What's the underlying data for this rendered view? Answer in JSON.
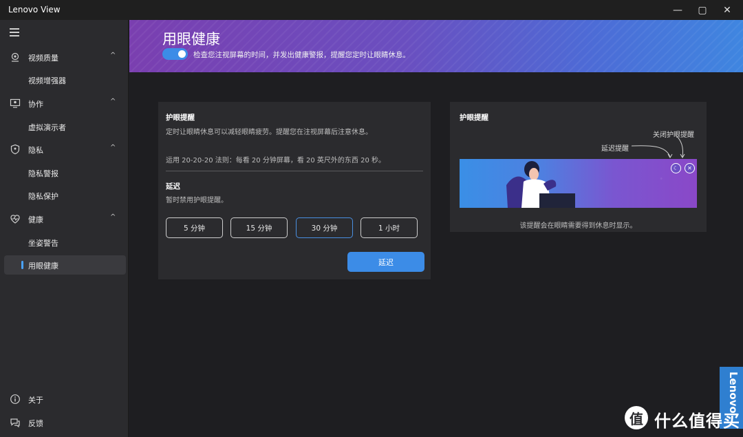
{
  "window": {
    "title": "Lenovo View",
    "minimize_glyph": "—",
    "maximize_glyph": "▢",
    "close_glyph": "✕"
  },
  "sidebar": {
    "menu_icon": "hamburger-icon",
    "groups": [
      {
        "label": "视频质量",
        "icon": "camera-icon",
        "expanded": true,
        "items": [
          {
            "label": "视频增强器"
          }
        ]
      },
      {
        "label": "协作",
        "icon": "presenter-icon",
        "expanded": true,
        "items": [
          {
            "label": "虚拟演示者"
          }
        ]
      },
      {
        "label": "隐私",
        "icon": "shield-icon",
        "expanded": true,
        "items": [
          {
            "label": "隐私警报"
          },
          {
            "label": "隐私保护"
          }
        ]
      },
      {
        "label": "健康",
        "icon": "heart-icon",
        "expanded": true,
        "items": [
          {
            "label": "坐姿警告"
          },
          {
            "label": "用眼健康",
            "active": true
          }
        ]
      }
    ],
    "footer": [
      {
        "label": "关于",
        "icon": "info-icon"
      },
      {
        "label": "反馈",
        "icon": "feedback-icon"
      }
    ],
    "chevron_glyph": "^"
  },
  "header": {
    "title": "用眼健康",
    "toggle_on": true,
    "description": "检查您注视屏幕的时间，并发出健康警报，提醒您定时让眼睛休息。"
  },
  "left_card": {
    "heading": "护眼提醒",
    "description": "定时让眼睛休息可以减轻眼睛疲劳。提醒您在注视屏幕后注意休息。",
    "rule": "运用 20-20-20 法则：每看 20 分钟屏幕，看 20 英尺外的东西 20 秒。",
    "delay_heading": "延迟",
    "delay_description": "暂时禁用护眼提醒。",
    "delay_options": [
      "5 分钟",
      "15 分钟",
      "30 分钟",
      "1 小时"
    ],
    "selected_option": "30 分钟",
    "delay_button": "延迟"
  },
  "right_card": {
    "heading": "护眼提醒",
    "annotation_close": "关闭护眼提醒",
    "annotation_snooze": "延迟提醒",
    "caption": "该提醒会在眼睛需要得到休息时显示。"
  },
  "brand": {
    "tab_text": "Lenovo",
    "watermark_icon_text": "值",
    "watermark_text": "什么值得买"
  },
  "colors": {
    "accent": "#3c8ce7",
    "banner_start": "#7a3fb0",
    "banner_end": "#3f86e0"
  }
}
